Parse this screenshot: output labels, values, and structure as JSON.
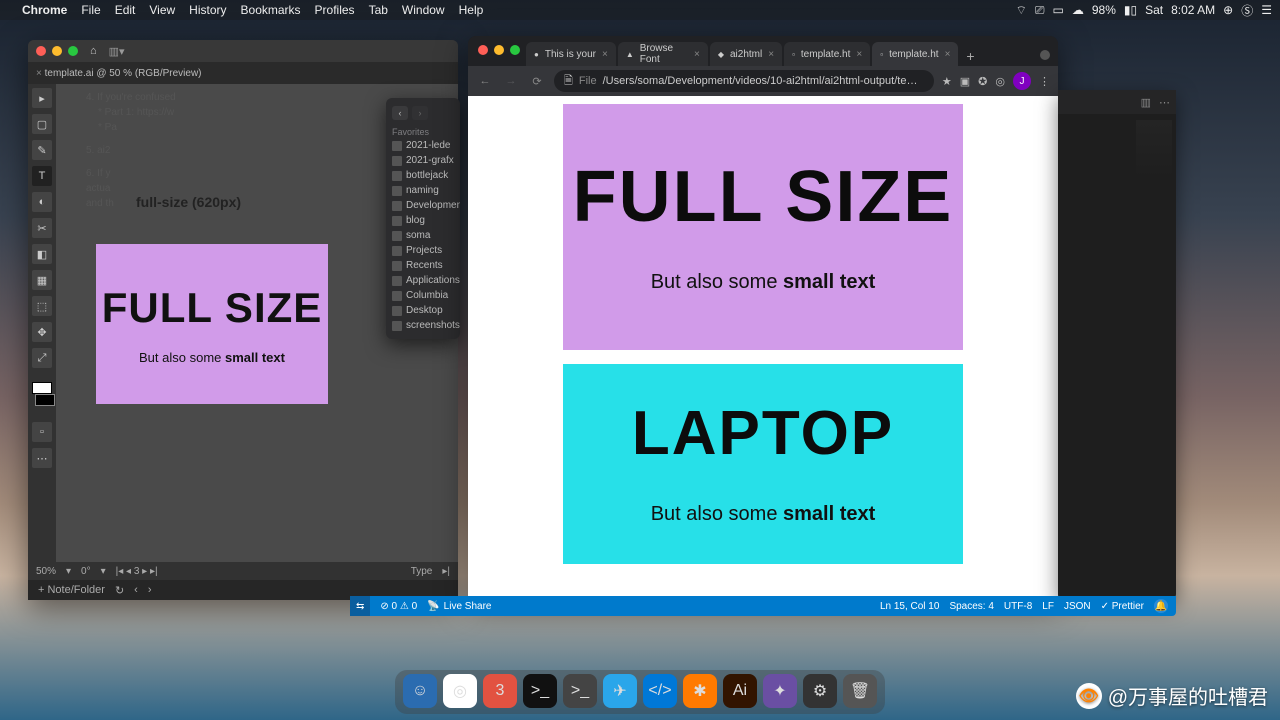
{
  "menubar": {
    "app": "Chrome",
    "items": [
      "File",
      "Edit",
      "View",
      "History",
      "Bookmarks",
      "Profiles",
      "Tab",
      "Window",
      "Help"
    ],
    "battery": "98%",
    "day": "Sat",
    "time": "8:02 AM"
  },
  "illustrator": {
    "home_icon": "⌂",
    "tab": "template.ai @ 50 % (RGB/Preview)",
    "tools": [
      "▸",
      "▢",
      "✎",
      "T",
      "◐",
      "✂",
      "◧",
      "▦",
      "⬚",
      "✥",
      "⤢"
    ],
    "doc_lines": {
      "l1": "4. If you're confused",
      "l2": "* Part 1: https://w",
      "l3": "* Pa",
      "l4": "5. ai2",
      "l5": "6. If y",
      "l6": "actua",
      "l7": "and th"
    },
    "artboard_label": "full-size (620px)",
    "artboard1": {
      "big": "FULL SIZE",
      "sub_pre": "But also some ",
      "sub_b": "small text"
    },
    "status": {
      "zoom": "50%",
      "rot": "0°",
      "page": "3",
      "type_label": "Type"
    },
    "bottom": {
      "add": "+ Note/Folder",
      "refresh": "↻",
      "back": "‹",
      "fwd": "›"
    }
  },
  "finder": {
    "section": "Favorites",
    "items": [
      "2021-lede",
      "2021-grafx",
      "bottlejack",
      "naming",
      "Development",
      "blog",
      "soma",
      "Projects",
      "Recents",
      "Applications",
      "Columbia",
      "Desktop",
      "screenshots"
    ]
  },
  "chrome": {
    "tabs": [
      {
        "label": "This is your",
        "active": false,
        "icon": "●"
      },
      {
        "label": "Browse Font",
        "active": false,
        "icon": "▲"
      },
      {
        "label": "ai2html",
        "active": false,
        "icon": "◆"
      },
      {
        "label": "template.ht",
        "active": false,
        "icon": "▫"
      },
      {
        "label": "template.ht",
        "active": true,
        "icon": "▫"
      }
    ],
    "nav": {
      "back": "←",
      "fwd": "→",
      "reload": "⟳"
    },
    "url_scheme": "File",
    "url": "/Users/soma/Development/videos/10-ai2html/ai2html-output/te…",
    "ext_icons": [
      "★",
      "▣",
      "✪",
      "◎",
      "⋮"
    ],
    "account": "J",
    "card1": {
      "huge": "FULL SIZE",
      "sub_pre": "But also some ",
      "sub_b": "small text"
    },
    "card2": {
      "huge": "LAPTOP",
      "sub_pre": "But also some ",
      "sub_b": "small text"
    }
  },
  "vscode_status": {
    "remote": "⇆",
    "problems": "⊘ 0 ⚠ 0",
    "live": "Live Share",
    "pos": "Ln 15, Col 10",
    "spaces": "Spaces: 4",
    "enc": "UTF-8",
    "eol": "LF",
    "lang": "JSON",
    "prettier": "✓ Prettier"
  },
  "dock": [
    {
      "bg": "#2b6cb0",
      "g": "☺"
    },
    {
      "bg": "#fff",
      "g": "◎"
    },
    {
      "bg": "#e25241",
      "g": "3"
    },
    {
      "bg": "#111",
      "g": ">_"
    },
    {
      "bg": "#444",
      "g": ">_"
    },
    {
      "bg": "#2aa6ea",
      "g": "✈"
    },
    {
      "bg": "#0078d7",
      "g": "</>"
    },
    {
      "bg": "#ff7a00",
      "g": "✱"
    },
    {
      "bg": "#321400",
      "g": "Ai"
    },
    {
      "bg": "#6a4fa3",
      "g": "✦"
    },
    {
      "bg": "#333",
      "g": "⚙"
    },
    {
      "bg": "#555",
      "g": "🗑"
    }
  ],
  "watermark": "@万事屋的吐槽君"
}
